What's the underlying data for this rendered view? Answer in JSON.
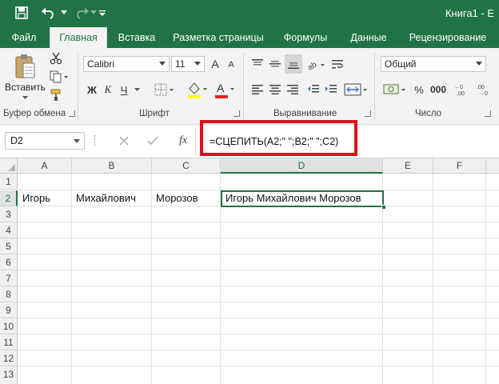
{
  "window": {
    "title": "Книга1 - E"
  },
  "tabs": [
    {
      "label": "Файл"
    },
    {
      "label": "Главная"
    },
    {
      "label": "Вставка"
    },
    {
      "label": "Разметка страницы"
    },
    {
      "label": "Формулы"
    },
    {
      "label": "Данные"
    },
    {
      "label": "Рецензирование"
    }
  ],
  "ribbon": {
    "clipboard": {
      "paste_label": "Вставить",
      "group_label": "Буфер обмена"
    },
    "font": {
      "font_name": "Calibri",
      "font_size": "11",
      "bold_label": "Ж",
      "italic_label": "К",
      "underline_label": "Ч",
      "grow_label": "A",
      "shrink_label": "A",
      "group_label": "Шрифт"
    },
    "alignment": {
      "group_label": "Выравнивание"
    },
    "number": {
      "format": "Общий",
      "group_label": "Число"
    }
  },
  "formula_bar": {
    "name_box": "D2",
    "fx_label": "fx",
    "formula": "=СЦЕПИТЬ(A2;\" \";B2;\" \";C2)"
  },
  "sheet": {
    "columns": [
      "A",
      "B",
      "C",
      "D",
      "E",
      "F"
    ],
    "rows": [
      "1",
      "2",
      "3",
      "4",
      "5",
      "6",
      "7",
      "8",
      "9",
      "10",
      "11",
      "12",
      "13"
    ],
    "cells": {
      "A2": "Игорь",
      "B2": "Михайлович",
      "C2": "Морозов",
      "D2": "Игорь Михайлович Морозов"
    },
    "active_cell": "D2"
  },
  "colors": {
    "accent": "#217346",
    "highlight": "#d9131c"
  }
}
